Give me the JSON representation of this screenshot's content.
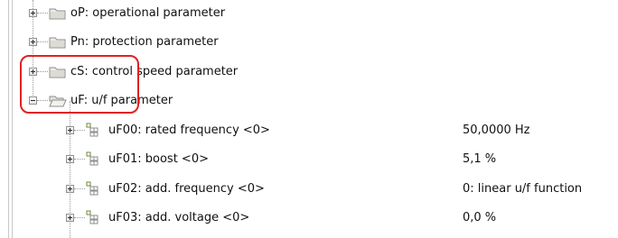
{
  "tree": {
    "groups": [
      {
        "label": "oP: operational parameter",
        "expanded": false
      },
      {
        "label": "Pn: protection parameter",
        "expanded": false
      },
      {
        "label": "cS: control speed parameter",
        "expanded": false
      },
      {
        "label": "uF: u/f parameter",
        "expanded": true
      }
    ],
    "params": [
      {
        "label": "uF00: rated frequency <0>",
        "value": "50,0000 Hz"
      },
      {
        "label": "uF01: boost <0>",
        "value": "5,1 %"
      },
      {
        "label": "uF02: add. frequency <0>",
        "value": "0: linear u/f function"
      },
      {
        "label": "uF03: add. voltage <0>",
        "value": "0,0 %"
      }
    ]
  },
  "annotation": {
    "color": "#e02020"
  },
  "icons": {
    "folder_closed": "folder-closed-icon",
    "folder_open": "folder-open-icon",
    "parameter": "parameter-icon",
    "expand": "expand-plus-icon",
    "collapse": "collapse-minus-icon"
  }
}
